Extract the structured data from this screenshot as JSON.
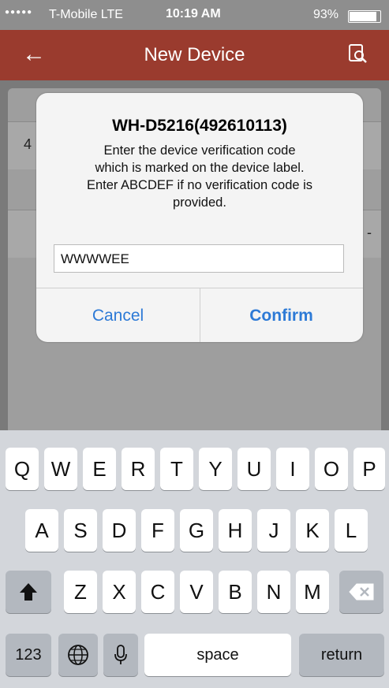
{
  "status_bar": {
    "carrier": "T-Mobile  LTE",
    "time": "10:19 AM",
    "battery": "93%"
  },
  "header": {
    "title": "New Device",
    "back_icon": "arrow-left-icon",
    "scan_icon": "search-document-icon"
  },
  "background": {
    "row1_peek": "4",
    "row2_peek": "-"
  },
  "dialog": {
    "title": "WH-D5216(492610113)",
    "message_line1": "Enter the device verification code",
    "message_line2": "which is marked on the device label.",
    "message_line3": "Enter ABCDEF if no verification code is",
    "message_line4": "provided.",
    "input_value": "WWWWEE",
    "cancel_label": "Cancel",
    "confirm_label": "Confirm",
    "accent": "#2d7ad6"
  },
  "keyboard": {
    "row1": [
      "Q",
      "W",
      "E",
      "R",
      "T",
      "Y",
      "U",
      "I",
      "O",
      "P"
    ],
    "row2": [
      "A",
      "S",
      "D",
      "F",
      "G",
      "H",
      "J",
      "K",
      "L"
    ],
    "row3": [
      "Z",
      "X",
      "C",
      "V",
      "B",
      "N",
      "M"
    ],
    "numbers_label": "123",
    "space_label": "space",
    "return_label": "return"
  },
  "colors": {
    "header": "#9a3b2e",
    "keyboard_bg": "#d3d6db"
  }
}
